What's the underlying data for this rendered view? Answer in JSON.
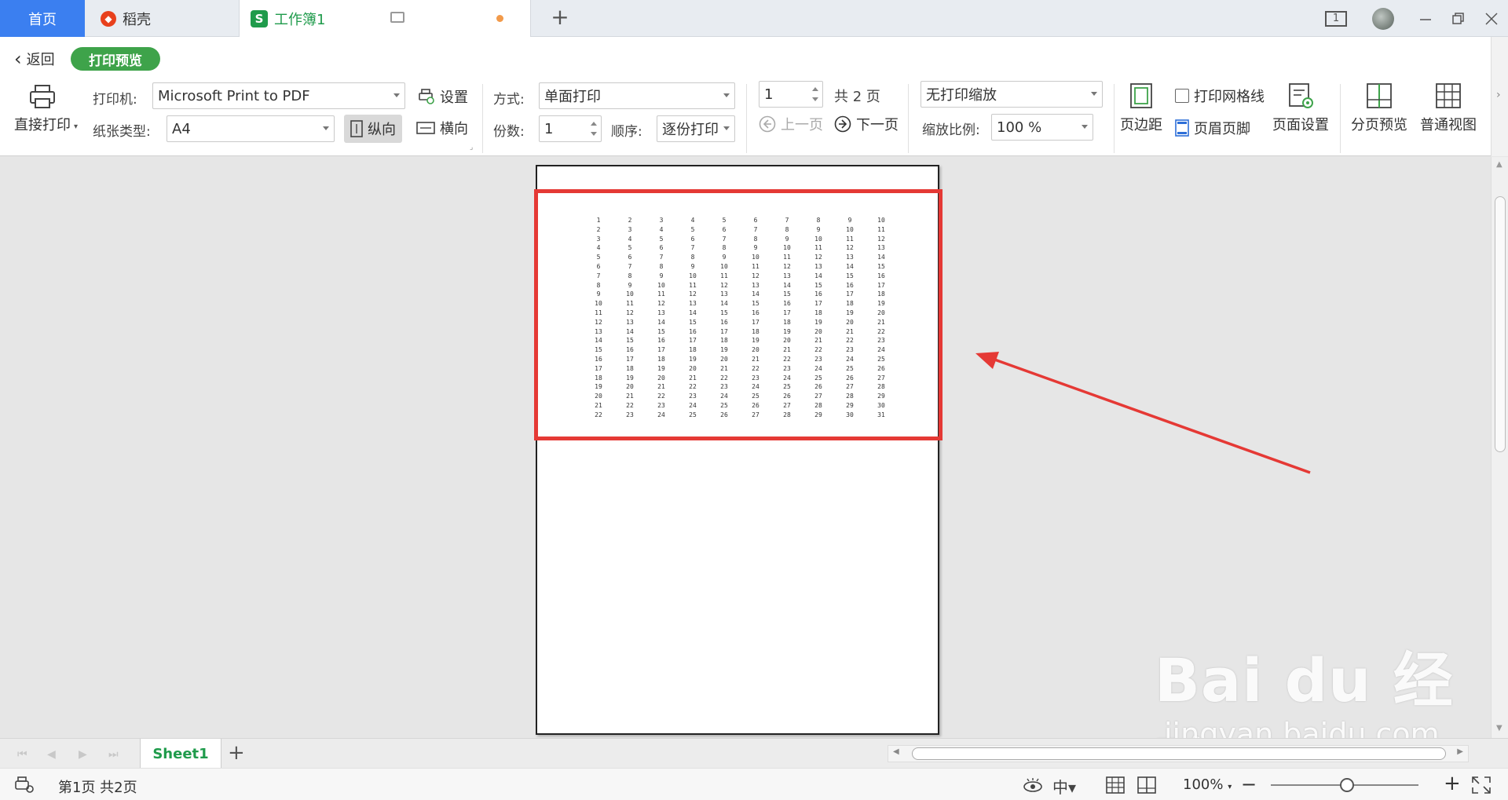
{
  "tabs": {
    "home": "首页",
    "daoke": "稻壳",
    "workbook": "工作簿1"
  },
  "window": {
    "page_count_badge": "1"
  },
  "toolbar": {
    "back": "返回",
    "mode_badge": "打印预览",
    "direct_print": "直接打印",
    "printer_label": "打印机:",
    "printer_value": "Microsoft Print to PDF",
    "settings": "设置",
    "paper_label": "纸张类型:",
    "paper_value": "A4",
    "portrait": "纵向",
    "landscape": "横向",
    "method_label": "方式:",
    "method_value": "单面打印",
    "copies_label": "份数:",
    "copies_value": "1",
    "order_label": "顺序:",
    "order_value": "逐份打印",
    "page_input": "1",
    "total_pages": "共 2 页",
    "prev_page": "上一页",
    "next_page": "下一页",
    "scaling_value": "无打印缩放",
    "scale_label": "缩放比例:",
    "scale_value": "100 %",
    "margins": "页边距",
    "print_gridlines": "打印网格线",
    "header_footer": "页眉页脚",
    "page_setup": "页面设置",
    "page_break_preview": "分页预览",
    "normal_view": "普通视图"
  },
  "sheet": {
    "active_tab": "Sheet1"
  },
  "status": {
    "page_info": "第1页 共2页",
    "zoom": "100%"
  },
  "watermark": {
    "main": "Bai du 经验",
    "sub": "jingyan.baidu.com"
  },
  "colors": {
    "accent_green": "#3ea34a",
    "tab_blue": "#3b7ff0",
    "highlight_red": "#e53935"
  },
  "preview_grid": {
    "columns": 10,
    "rows": 22,
    "rule": "cell value = row index + column index - 1"
  }
}
